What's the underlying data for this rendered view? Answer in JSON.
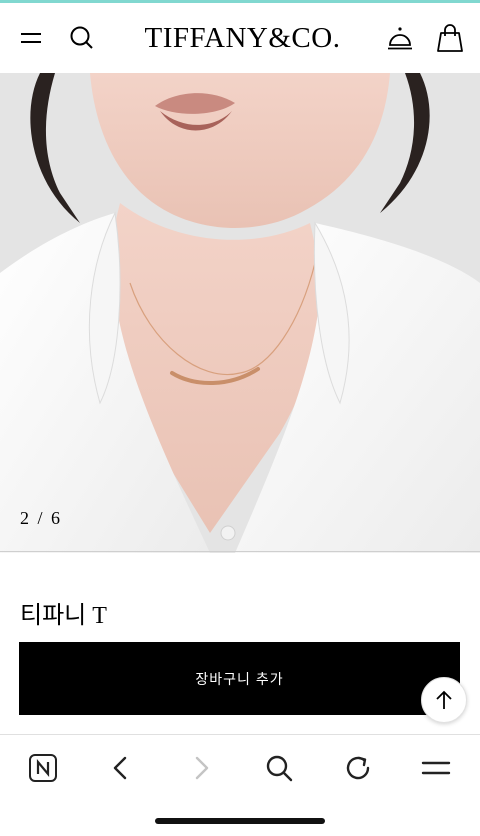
{
  "colors": {
    "accent": "#81d8d0",
    "button_bg": "#000000",
    "button_text": "#ffffff"
  },
  "header": {
    "logo": "TIFFANY&CO.",
    "icons": [
      "menu-icon",
      "search-icon",
      "concierge-bell-icon",
      "shopping-bag-icon"
    ]
  },
  "gallery": {
    "counter": "2 / 6",
    "current": 2,
    "total": 6
  },
  "product": {
    "title": "티파니 T",
    "add_to_cart_label": "장바구니 추가"
  },
  "browser_toolbar": {
    "icons": [
      "naver-icon",
      "back-arrow-icon",
      "forward-arrow-icon",
      "search-icon",
      "refresh-icon",
      "menu-icon"
    ]
  }
}
